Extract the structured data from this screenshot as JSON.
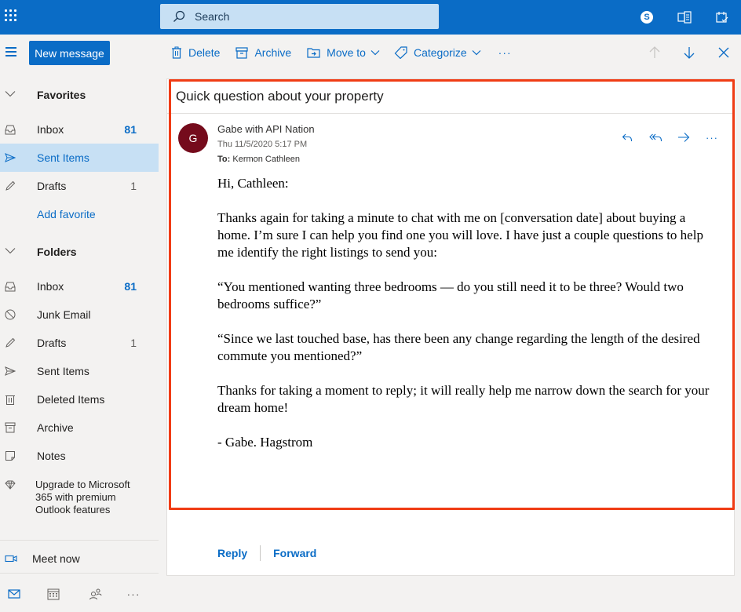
{
  "topbar": {
    "search_placeholder": "Search",
    "skype_letter": "S"
  },
  "command": {
    "new_message": "New message",
    "delete": "Delete",
    "archive": "Archive",
    "move_to": "Move to",
    "categorize": "Categorize",
    "more": "···"
  },
  "sidebar": {
    "favorites_label": "Favorites",
    "favorites": [
      {
        "label": "Inbox",
        "count": "81"
      },
      {
        "label": "Sent Items",
        "count": ""
      },
      {
        "label": "Drafts",
        "count": "1"
      }
    ],
    "add_favorite": "Add favorite",
    "folders_label": "Folders",
    "folders": [
      {
        "label": "Inbox",
        "count": "81"
      },
      {
        "label": "Junk Email",
        "count": ""
      },
      {
        "label": "Drafts",
        "count": "1"
      },
      {
        "label": "Sent Items",
        "count": ""
      },
      {
        "label": "Deleted Items",
        "count": ""
      },
      {
        "label": "Archive",
        "count": ""
      },
      {
        "label": "Notes",
        "count": ""
      }
    ],
    "upgrade": "Upgrade to Microsoft 365 with premium Outlook features",
    "meet_now": "Meet now",
    "more": "···"
  },
  "email": {
    "subject": "Quick question about your property",
    "avatar_initial": "G",
    "sender": "Gabe with API Nation",
    "date": "Thu 11/5/2020 5:17 PM",
    "to_label": "To:",
    "to_name": "Kermon Cathleen",
    "more": "···",
    "body": [
      "Hi, Cathleen:",
      "Thanks again for taking a minute to chat with me on [conversation date] about buying a home. I’m sure I can help you find one you will love. I have just a couple questions to help me identify the right listings to send you:",
      "“You mentioned wanting three bedrooms — do you still need it to be three? Would two bedrooms suffice?”",
      "“Since we last touched base, has there been any change regarding the length of the desired commute you mentioned?”",
      "Thanks for taking a moment to reply; it will really help me narrow down the search for your dream home!",
      "- Gabe. Hagstrom"
    ],
    "reply": "Reply",
    "forward": "Forward"
  },
  "colors": {
    "brand": "#0a6cc6",
    "selected": "#c7e0f4",
    "avatar": "#750b1c",
    "highlight": "#f03c15"
  },
  "icons": [
    "waffle-icon",
    "search-icon",
    "skype-icon",
    "office-icon",
    "feedback-icon",
    "hamburger-icon",
    "trash-icon",
    "archive-icon",
    "move-icon",
    "tag-icon",
    "chevron-down-icon",
    "arrow-up-icon",
    "arrow-down-icon",
    "close-icon",
    "inbox-icon",
    "send-icon",
    "pencil-icon",
    "junk-icon",
    "notes-icon",
    "diamond-icon",
    "video-icon",
    "mail-icon",
    "calendar-icon",
    "people-icon",
    "reply-icon",
    "reply-all-icon",
    "forward-icon"
  ]
}
